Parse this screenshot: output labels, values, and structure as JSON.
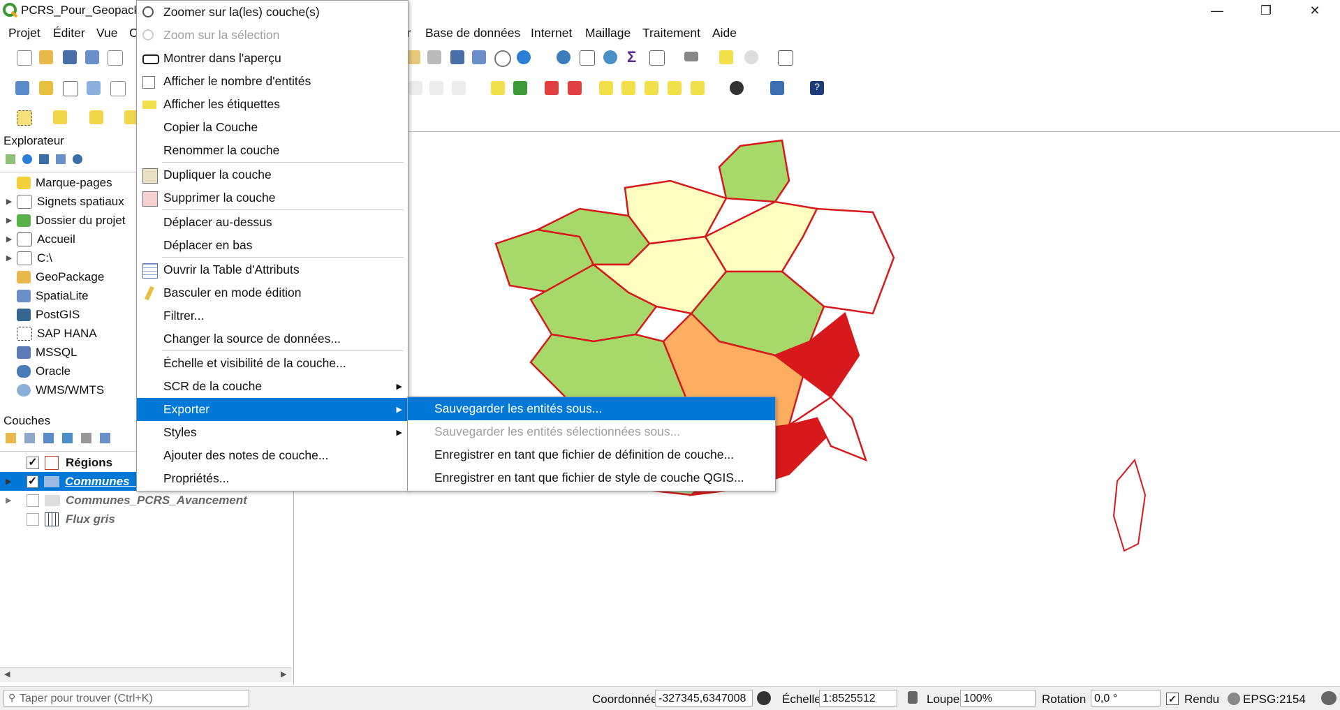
{
  "window": {
    "title": "PCRS_Pour_Geopacka"
  },
  "menubar": {
    "items": [
      "Projet",
      "Éditer",
      "Vue",
      "C",
      "r",
      "Base de données",
      "Internet",
      "Maillage",
      "Traitement",
      "Aide"
    ]
  },
  "explorer": {
    "title": "Explorateur",
    "items": [
      {
        "label": "Marque-pages",
        "icon": "star-icon"
      },
      {
        "label": "Signets spatiaux",
        "icon": "bookmark-icon"
      },
      {
        "label": "Dossier du projet",
        "icon": "project-folder-icon"
      },
      {
        "label": "Accueil",
        "icon": "home-icon"
      },
      {
        "label": "C:\\",
        "icon": "folder-icon"
      },
      {
        "label": "GeoPackage",
        "icon": "geopackage-icon"
      },
      {
        "label": "SpatiaLite",
        "icon": "spatialite-icon"
      },
      {
        "label": "PostGIS",
        "icon": "postgis-icon"
      },
      {
        "label": "SAP HANA",
        "icon": "sap-hana-icon"
      },
      {
        "label": "MSSQL",
        "icon": "mssql-icon"
      },
      {
        "label": "Oracle",
        "icon": "oracle-icon"
      },
      {
        "label": "WMS/WMTS",
        "icon": "wms-icon"
      }
    ]
  },
  "layers": {
    "title": "Couches",
    "items": [
      {
        "label": "Régions",
        "checked": "✓"
      },
      {
        "label": "Communes_",
        "checked": "✓"
      },
      {
        "label": "Communes_PCRS_Avancement",
        "checked": ""
      },
      {
        "label": "Flux gris",
        "checked": ""
      }
    ]
  },
  "context_menu": {
    "items": [
      {
        "label": "Zoomer sur la(les) couche(s)",
        "icon": "zoom-layer-icon"
      },
      {
        "label": "Zoom sur la sélection",
        "icon": "zoom-selection-icon"
      },
      {
        "label": "Montrer dans l'aperçu",
        "icon": "overview-icon"
      },
      {
        "label": "Afficher le nombre d'entités",
        "icon": "checkbox-icon"
      },
      {
        "label": "Afficher les étiquettes",
        "icon": "labels-icon"
      },
      {
        "label": "Copier la Couche",
        "icon": ""
      },
      {
        "label": "Renommer la couche",
        "icon": ""
      },
      {
        "label": "Dupliquer la couche",
        "icon": "duplicate-layer-icon"
      },
      {
        "label": "Supprimer la couche",
        "icon": "remove-layer-icon"
      },
      {
        "label": "Déplacer au-dessus",
        "icon": ""
      },
      {
        "label": "Déplacer en bas",
        "icon": ""
      },
      {
        "label": "Ouvrir la Table d'Attributs",
        "icon": "attribute-table-icon"
      },
      {
        "label": "Basculer en mode édition",
        "icon": "pencil-icon"
      },
      {
        "label": "Filtrer...",
        "icon": ""
      },
      {
        "label": "Changer la source de données...",
        "icon": ""
      },
      {
        "label": "Échelle et visibilité de la couche...",
        "icon": ""
      },
      {
        "label": "SCR de la couche",
        "icon": ""
      },
      {
        "label": "Exporter",
        "icon": ""
      },
      {
        "label": "Styles",
        "icon": ""
      },
      {
        "label": "Ajouter des notes de couche...",
        "icon": ""
      },
      {
        "label": "Propriétés...",
        "icon": ""
      }
    ]
  },
  "export_submenu": {
    "items": [
      "Sauvegarder les entités sous...",
      "Sauvegarder les entités sélectionnées sous...",
      "Enregistrer en tant que fichier de définition de couche...",
      "Enregistrer en tant que fichier de style de couche QGIS..."
    ]
  },
  "statusbar": {
    "search_placeholder": "Taper pour trouver (Ctrl+K)",
    "coord_label": "Coordonnée",
    "coord_value": "-327345,6347008",
    "scale_label": "Échelle",
    "scale_value": "1:8525512",
    "magnifier_label": "Loupe",
    "magnifier_value": "100%",
    "rotation_label": "Rotation",
    "rotation_value": "0,0 °",
    "render_label": "Rendu",
    "crs": "EPSG:2154"
  },
  "colors": {
    "highlight": "#0078d7",
    "region_border": "#d7191c",
    "class_1": "#a6d96a",
    "class_2": "#ffffbf",
    "class_3": "#fdae61",
    "class_4": "#d7191c",
    "class_5": "#abdda4"
  }
}
